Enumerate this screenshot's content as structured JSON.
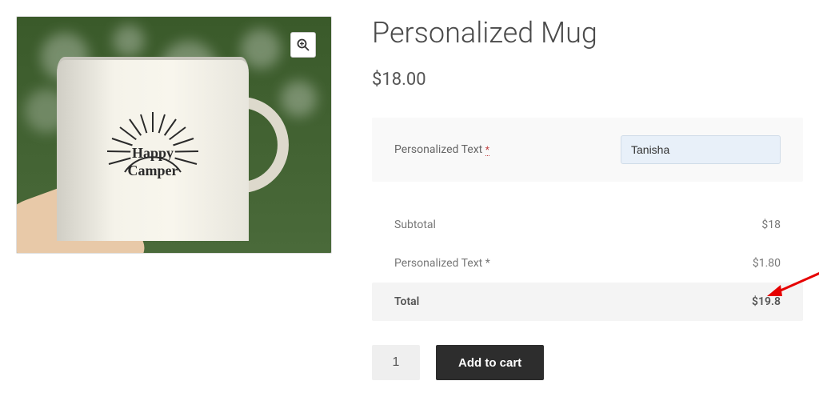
{
  "product": {
    "title": "Personalized Mug",
    "price": "$18.00",
    "image_alt": "Happy Camper Mug"
  },
  "options": {
    "personalized_text_label": "Personalized Text",
    "required_mark": "*",
    "personalized_text_value": "Tanisha"
  },
  "pricing": {
    "subtotal_label": "Subtotal",
    "subtotal_value": "$18",
    "addon_label": "Personalized Text *",
    "addon_value": "$1.80",
    "total_label": "Total",
    "total_value": "$19.8"
  },
  "cart": {
    "quantity": "1",
    "add_to_cart_label": "Add to cart"
  },
  "icons": {
    "zoom": "magnify-plus-icon"
  },
  "mug_design": {
    "line1": "Happy",
    "line2": "Camper"
  }
}
